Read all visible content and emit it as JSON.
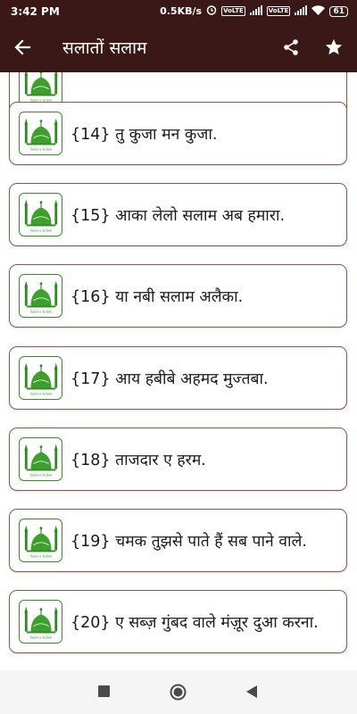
{
  "status_bar": {
    "time": "3:42 PM",
    "speed": "0.5KB/s",
    "network_labels": [
      "VoLTE",
      "4G",
      "VoLTE"
    ],
    "battery": "61"
  },
  "app_bar": {
    "title": "सलातों सलाम",
    "back_icon": "arrow-left-icon",
    "share_icon": "share-icon",
    "favorite_icon": "star-icon"
  },
  "list": {
    "items": [
      {
        "label": ""
      },
      {
        "label": "{14} तु कुजा मन कुजा."
      },
      {
        "label": "{15} आका लेलो सलाम अब हमारा."
      },
      {
        "label": "{16} या नबी सलाम अलैका."
      },
      {
        "label": "{17} आय हबीबे अहमद मुज्तबा."
      },
      {
        "label": "{18} ताजदार ए हरम."
      },
      {
        "label": "{19} चमक तुझसे पाते हैं सब पाने वाले."
      },
      {
        "label": "{20} ए सब्ज़ गुंबद वाले मंज़ूर दुआ करना."
      }
    ],
    "icon_name": "mosque-salat-o-salam-icon",
    "icon_caption": "Salat o Salam"
  },
  "nav_bar": {
    "recents_icon": "square-icon",
    "home_icon": "circle-icon",
    "back_icon": "triangle-back-icon"
  },
  "colors": {
    "app_bar": "#3a1818",
    "card_border": "#8b5a4a",
    "icon_green": "#3a8a2a"
  }
}
